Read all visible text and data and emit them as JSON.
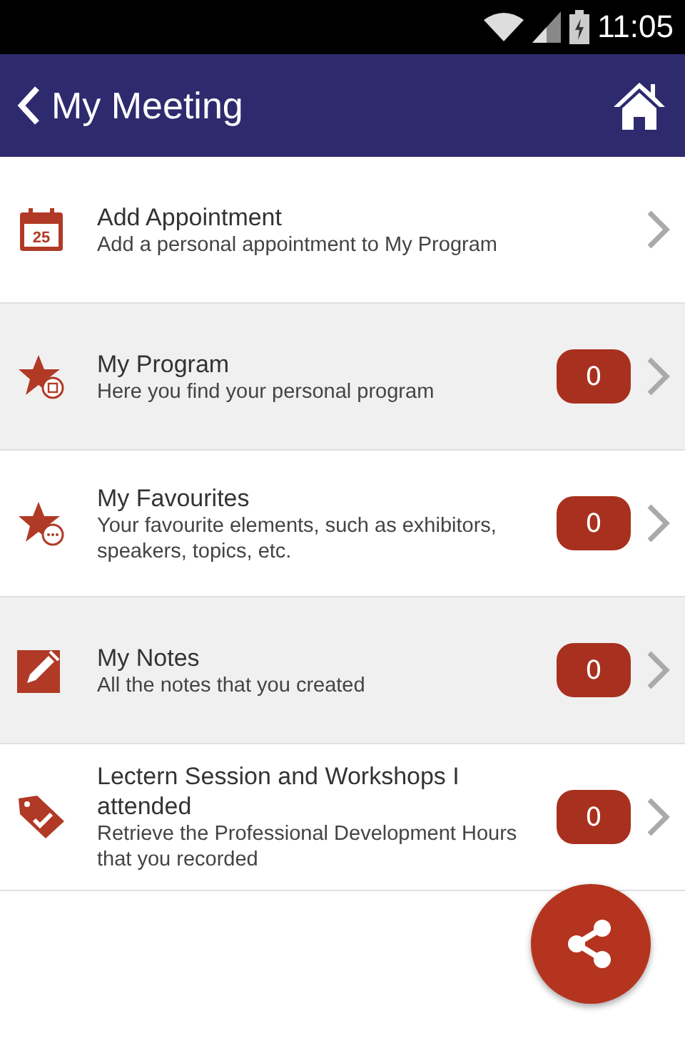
{
  "status_bar": {
    "time": "11:05"
  },
  "header": {
    "title": "My Meeting"
  },
  "items": [
    {
      "kind": "calendar",
      "icon_text": "25",
      "title": "Add Appointment",
      "description": "Add a personal appointment to My Program"
    },
    {
      "kind": "star-calendar",
      "title": "My Program",
      "description": "Here you find your personal program",
      "count": "0"
    },
    {
      "kind": "star-chat",
      "title": "My Favourites",
      "description": "Your favourite elements, such as exhibitors, speakers, topics, etc.",
      "count": "0"
    },
    {
      "kind": "note",
      "title": "My Notes",
      "description": "All the notes that you created",
      "count": "0"
    },
    {
      "kind": "tag",
      "title": "Lectern Session and Workshops I attended",
      "description": "Retrieve the Professional Development Hours that you recorded",
      "count": "0"
    }
  ]
}
